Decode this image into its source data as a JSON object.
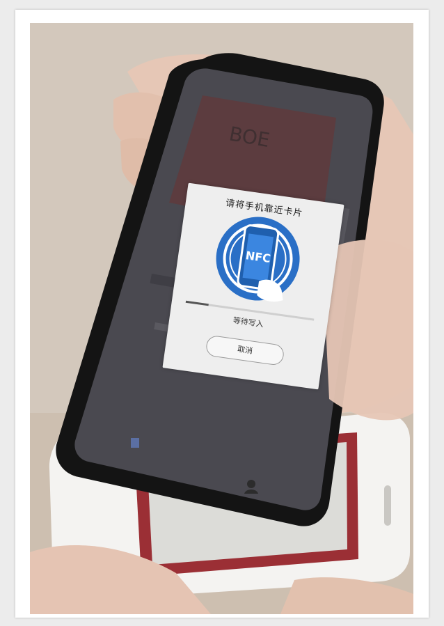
{
  "scene": {
    "description_free": true,
    "phone_brand_text": "BOE"
  },
  "nfc_dialog": {
    "title": "请将手机靠近卡片",
    "emblem_label": "NFC",
    "status": "等待写入",
    "cancel_label": "取消",
    "progress_fraction": 0.18
  },
  "colors": {
    "nfc_blue": "#2a6fc6",
    "card_red": "#9b2f35",
    "phone_body": "#141414"
  },
  "icons": {
    "nfc": "nfc-phone-icon",
    "nav_left": "card-icon",
    "nav_right": "user-icon"
  }
}
